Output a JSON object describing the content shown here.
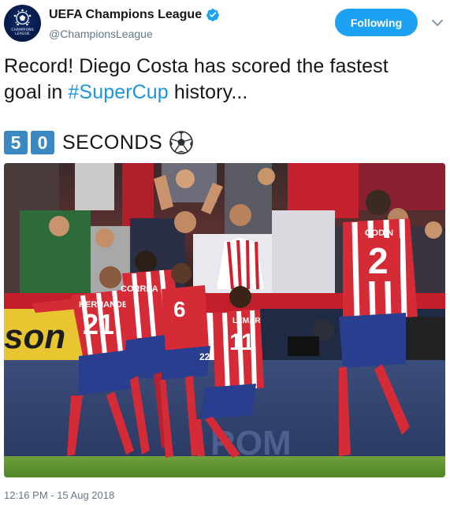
{
  "account": {
    "display_name": "UEFA Champions League",
    "handle": "@ChampionsLeague",
    "avatar_text": "CHAMPIONS LEAGUE"
  },
  "follow_button": {
    "label": "Following"
  },
  "tweet": {
    "line1": "Record! Diego Costa has scored the fastest",
    "line2_before": "goal in ",
    "hashtag": "#SuperCup",
    "line2_after": " history...",
    "digits": [
      "5",
      "0"
    ],
    "seconds_word": "SECONDS",
    "ball_icon": "soccer-ball-icon"
  },
  "photo": {
    "jersey_numbers": [
      "21",
      "2",
      "11",
      "6",
      "22"
    ],
    "player_names": [
      "HERNANDEZ",
      "CORREA",
      "GODIN",
      "LEMAR"
    ],
    "board_text": "son",
    "ad_board_text": "ROM"
  },
  "meta": {
    "timestamp": "12:16 PM - 15 Aug 2018"
  },
  "colors": {
    "accent": "#1da1f2",
    "hashtag": "#1b95e0",
    "digit_bg": "#3b88c3",
    "muted": "#657786"
  }
}
